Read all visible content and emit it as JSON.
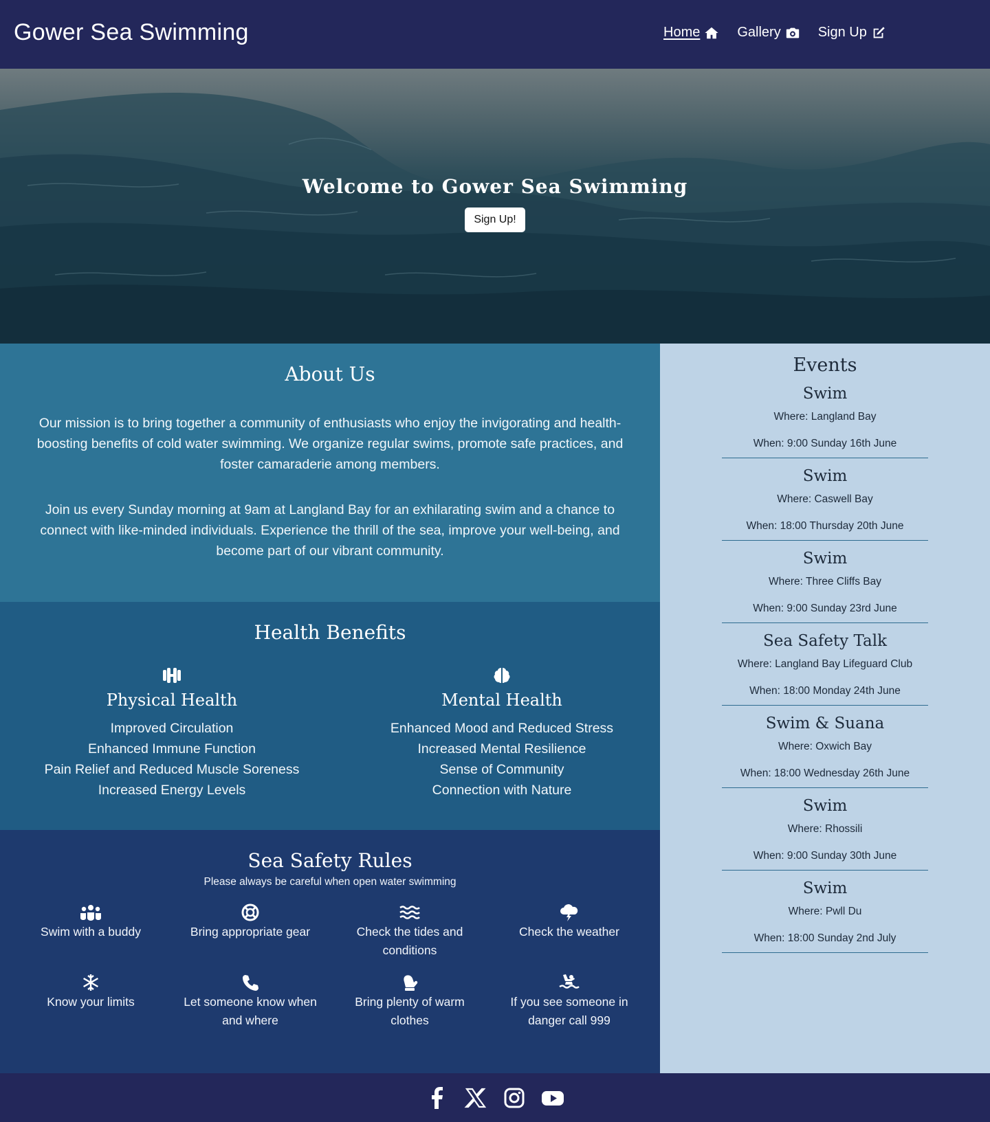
{
  "header": {
    "brand": "Gower Sea Swimming",
    "nav": [
      {
        "label": "Home",
        "icon": "home-icon",
        "active": true
      },
      {
        "label": "Gallery",
        "icon": "camera-icon",
        "active": false
      },
      {
        "label": "Sign Up",
        "icon": "edit-icon",
        "active": false
      }
    ]
  },
  "hero": {
    "title": "Welcome to Gower Sea Swimming",
    "button": "Sign Up!"
  },
  "about": {
    "title": "About Us",
    "paragraphs": [
      "Our mission is to bring together a community of enthusiasts who enjoy the invigorating and health-boosting benefits of cold water swimming. We organize regular swims, promote safe practices, and foster camaraderie among members.",
      "Join us every Sunday morning at 9am at Langland Bay for an exhilarating swim and a chance to connect with like-minded individuals. Experience the thrill of the sea, improve your well-being, and become part of our vibrant community."
    ]
  },
  "health": {
    "title": "Health Benefits",
    "columns": [
      {
        "icon": "dumbbell-icon",
        "title": "Physical Health",
        "items": [
          "Improved Circulation",
          "Enhanced Immune Function",
          "Pain Relief and Reduced Muscle Soreness",
          "Increased Energy Levels"
        ]
      },
      {
        "icon": "brain-icon",
        "title": "Mental Health",
        "items": [
          "Enhanced Mood and Reduced Stress",
          "Increased Mental Resilience",
          "Sense of Community",
          "Connection with Nature"
        ]
      }
    ]
  },
  "safety": {
    "title": "Sea Safety Rules",
    "subtitle": "Please always be careful when open water swimming",
    "rules": [
      {
        "icon": "people-group-icon",
        "text": "Swim with a buddy"
      },
      {
        "icon": "life-ring-icon",
        "text": "Bring appropriate gear"
      },
      {
        "icon": "water-icon",
        "text": "Check the tides and conditions"
      },
      {
        "icon": "cloud-bolt-icon",
        "text": "Check the weather"
      },
      {
        "icon": "snowflake-icon",
        "text": "Know your limits"
      },
      {
        "icon": "phone-icon",
        "text": "Let someone know when and where"
      },
      {
        "icon": "mitten-icon",
        "text": "Bring plenty of warm clothes"
      },
      {
        "icon": "person-drowning-icon",
        "text": "If you see someone in danger call 999"
      }
    ]
  },
  "events": {
    "title": "Events",
    "items": [
      {
        "name": "Swim",
        "where": "Where: Langland Bay",
        "when": "When: 9:00 Sunday 16th June"
      },
      {
        "name": "Swim",
        "where": "Where: Caswell Bay",
        "when": "When: 18:00 Thursday 20th June"
      },
      {
        "name": "Swim",
        "where": "Where: Three Cliffs Bay",
        "when": "When: 9:00 Sunday 23rd June"
      },
      {
        "name": "Sea Safety Talk",
        "where": "Where: Langland Bay Lifeguard Club",
        "when": "When: 18:00 Monday 24th June"
      },
      {
        "name": "Swim & Suana",
        "where": "Where: Oxwich Bay",
        "when": "When: 18:00 Wednesday 26th June"
      },
      {
        "name": "Swim",
        "where": "Where: Rhossili",
        "when": "When: 9:00 Sunday 30th June"
      },
      {
        "name": "Swim",
        "where": "Where: Pwll Du",
        "when": "When: 18:00 Sunday 2nd July"
      }
    ]
  },
  "footer": {
    "social": [
      "facebook-icon",
      "x-icon",
      "instagram-icon",
      "youtube-icon"
    ]
  }
}
